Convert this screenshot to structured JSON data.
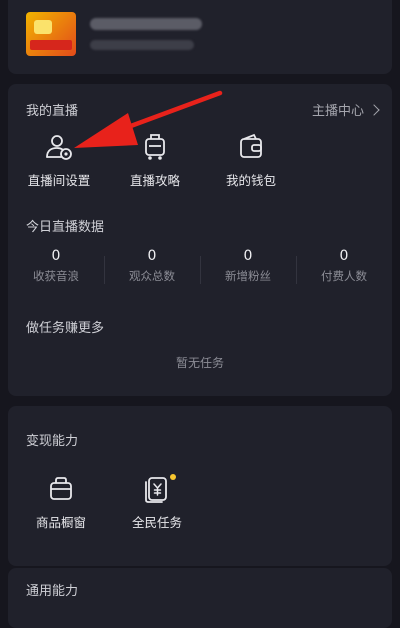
{
  "live_section": {
    "title": "我的直播",
    "anchor_center_label": "主播中心",
    "tools": [
      {
        "label": "直播间设置",
        "icon": "user-settings-icon"
      },
      {
        "label": "直播攻略",
        "icon": "cart-guide-icon"
      },
      {
        "label": "我的钱包",
        "icon": "wallet-icon"
      }
    ],
    "today_title": "今日直播数据",
    "stats": [
      {
        "value": "0",
        "label": "收获音浪"
      },
      {
        "value": "0",
        "label": "观众总数"
      },
      {
        "value": "0",
        "label": "新增粉丝"
      },
      {
        "value": "0",
        "label": "付费人数"
      }
    ],
    "tasks_title": "做任务赚更多",
    "tasks_empty": "暂无任务"
  },
  "monetization": {
    "title": "变现能力",
    "tools": [
      {
        "label": "商品橱窗",
        "icon": "shop-window-icon"
      },
      {
        "label": "全民任务",
        "icon": "task-yuan-icon"
      }
    ]
  },
  "general": {
    "title": "通用能力"
  },
  "colors": {
    "background": "#16161e",
    "card": "#20212b",
    "annotation_arrow": "#e8221b",
    "badge": "#f7c62f"
  }
}
